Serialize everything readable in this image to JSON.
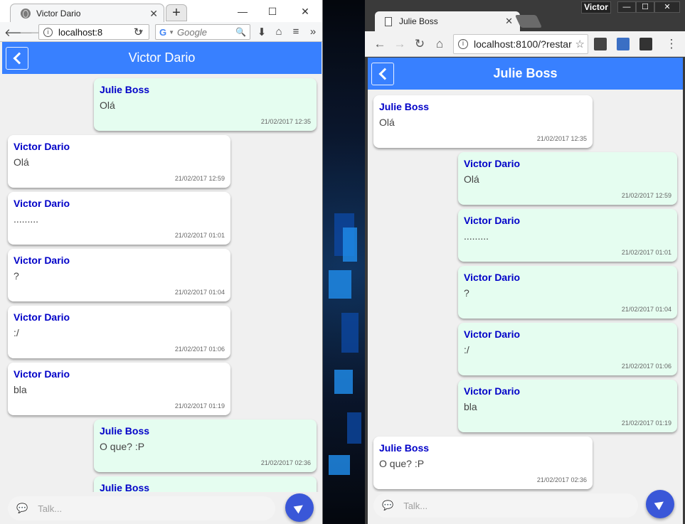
{
  "firefox": {
    "tab_title": "Victor Dario",
    "tab_close": "✕",
    "new_tab": "+",
    "url": "localhost:8",
    "search_placeholder": "Google",
    "app": {
      "title": "Victor Dario",
      "input_placeholder": "Talk...",
      "messages": [
        {
          "sender": "Julie Boss",
          "text": "Olá",
          "time": "21/02/2017 12:35",
          "side": "mine"
        },
        {
          "sender": "Victor Dario",
          "text": "Olá",
          "time": "21/02/2017 12:59",
          "side": "theirs"
        },
        {
          "sender": "Victor Dario",
          "text": ".........",
          "time": "21/02/2017 01:01",
          "side": "theirs"
        },
        {
          "sender": "Victor Dario",
          "text": "?",
          "time": "21/02/2017 01:04",
          "side": "theirs"
        },
        {
          "sender": "Victor Dario",
          "text": ":/",
          "time": "21/02/2017 01:06",
          "side": "theirs"
        },
        {
          "sender": "Victor Dario",
          "text": "bla",
          "time": "21/02/2017 01:19",
          "side": "theirs"
        },
        {
          "sender": "Julie Boss",
          "text": "O que? :P",
          "time": "21/02/2017 02:36",
          "side": "mine"
        },
        {
          "sender": "Julie Boss",
          "text": "",
          "time": "",
          "side": "mine"
        }
      ]
    }
  },
  "chrome": {
    "profile": "Victor",
    "tab_title": "Julie Boss",
    "tab_close": "✕",
    "url": "localhost:8100/?restar",
    "app": {
      "title": "Julie Boss",
      "input_placeholder": "Talk...",
      "messages": [
        {
          "sender": "Julie Boss",
          "text": "Olá",
          "time": "21/02/2017 12:35",
          "side": "theirs"
        },
        {
          "sender": "Victor Dario",
          "text": "Olá",
          "time": "21/02/2017 12:59",
          "side": "mine"
        },
        {
          "sender": "Victor Dario",
          "text": ".........",
          "time": "21/02/2017 01:01",
          "side": "mine"
        },
        {
          "sender": "Victor Dario",
          "text": "?",
          "time": "21/02/2017 01:04",
          "side": "mine"
        },
        {
          "sender": "Victor Dario",
          "text": ":/",
          "time": "21/02/2017 01:06",
          "side": "mine"
        },
        {
          "sender": "Victor Dario",
          "text": "bla",
          "time": "21/02/2017 01:19",
          "side": "mine"
        },
        {
          "sender": "Julie Boss",
          "text": "O que? :P",
          "time": "21/02/2017 02:36",
          "side": "theirs"
        }
      ]
    }
  },
  "colors": {
    "header_blue": "#3880ff",
    "sender_blue": "#0000c8",
    "mine_bubble": "#e5fdf0",
    "theirs_bubble": "#ffffff",
    "send_button": "#3a57d8"
  }
}
